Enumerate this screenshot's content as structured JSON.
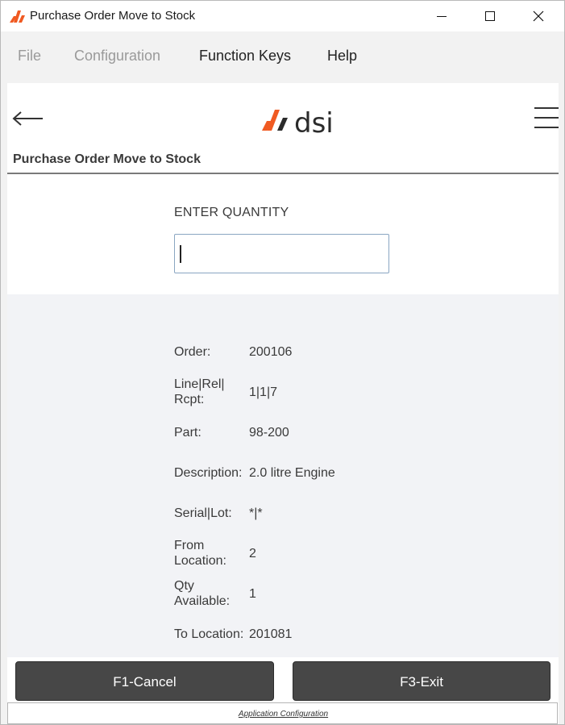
{
  "window": {
    "title": "Purchase Order Move to Stock",
    "controls": [
      "minimize",
      "maximize",
      "close"
    ]
  },
  "menu": {
    "items": [
      {
        "label": "File",
        "enabled": false
      },
      {
        "label": "Configuration",
        "enabled": false
      },
      {
        "label": "Function Keys",
        "enabled": true
      },
      {
        "label": "Help",
        "enabled": true
      }
    ]
  },
  "header": {
    "logo_text": "dsi",
    "page_title": "Purchase Order Move to Stock"
  },
  "form": {
    "quantity_label": "ENTER QUANTITY",
    "quantity_value": ""
  },
  "details": [
    {
      "label": "Order:",
      "value": "200106"
    },
    {
      "label": "Line|Rel| Rcpt:",
      "value": "1|1|7"
    },
    {
      "label": "Part:",
      "value": "98-200"
    },
    {
      "label": "Description:",
      "value": "2.0 litre Engine"
    },
    {
      "label": "Serial|Lot:",
      "value": "*|*"
    },
    {
      "label": "From Location:",
      "value": "2"
    },
    {
      "label": "Qty Available:",
      "value": "1"
    },
    {
      "label": "To Location:",
      "value": "201081"
    }
  ],
  "buttons": {
    "cancel": "F1-Cancel",
    "exit": "F3-Exit"
  },
  "footer": {
    "link": "Application Configuration"
  },
  "colors": {
    "brand_orange": "#f05a22",
    "logo_dark": "#2b2b2b",
    "button_bg": "#474747",
    "info_panel_bg": "#f2f3f6"
  }
}
